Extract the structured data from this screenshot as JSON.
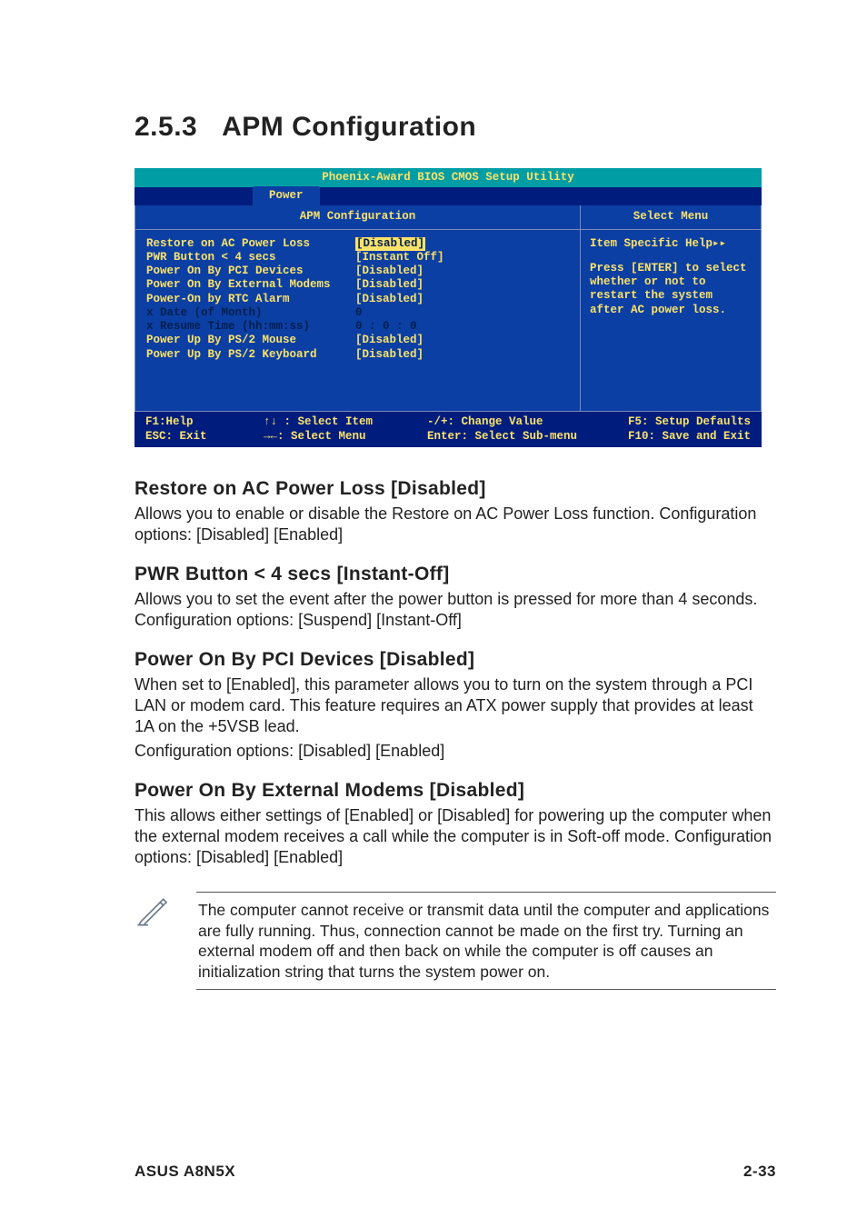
{
  "section": {
    "number": "2.5.3",
    "title": "APM Configuration"
  },
  "bios": {
    "title": "Phoenix-Award BIOS CMOS Setup Utility",
    "active_tab": "Power",
    "left_header": "APM Configuration",
    "right_header": "Select Menu",
    "rows": [
      {
        "label": "Restore on AC Power Loss",
        "value": "[Disabled]",
        "style": "highlight"
      },
      {
        "label": "PWR Button < 4 secs",
        "value": "[Instant Off]",
        "style": "normal"
      },
      {
        "label": "Power On By PCI Devices",
        "value": "[Disabled]",
        "style": "normal"
      },
      {
        "label": "Power On By External Modems",
        "value": "[Disabled]",
        "style": "normal"
      },
      {
        "label": "Power-On by RTC Alarm",
        "value": "[Disabled]",
        "style": "normal"
      },
      {
        "label": "x Date (of Month)",
        "value": "  0",
        "style": "dim"
      },
      {
        "label": "x Resume Time (hh:mm:ss)",
        "value": "0 : 0 : 0",
        "style": "dim"
      },
      {
        "label": "Power Up By PS/2 Mouse",
        "value": "[Disabled]",
        "style": "normal"
      },
      {
        "label": "Power Up By PS/2 Keyboard",
        "value": "[Disabled]",
        "style": "normal"
      }
    ],
    "help_title": "Item Specific Help",
    "help_body": "Press [ENTER] to select whether or not to restart the system after AC power loss.",
    "legend": {
      "f1": "F1:Help",
      "esc": "ESC: Exit",
      "updown": "↑↓ : Select Item",
      "leftright": "→←: Select Menu",
      "changeval": "-/+: Change Value",
      "submenu": "Enter: Select Sub-menu",
      "f5": "F5: Setup Defaults",
      "f10": "F10: Save and Exit"
    }
  },
  "items": {
    "restore": {
      "heading": "Restore on AC Power Loss [Disabled]",
      "p1": "Allows you to enable or disable the Restore on AC Power Loss function. Configuration options: [Disabled] [Enabled]"
    },
    "pwrbtn": {
      "heading": "PWR Button < 4 secs [Instant-Off]",
      "p1": "Allows you to set the event after the power button is pressed for more than 4 seconds. Configuration options: [Suspend] [Instant-Off]"
    },
    "pci": {
      "heading": "Power On By PCI Devices [Disabled]",
      "p1": "When set to [Enabled], this parameter allows you to turn on the system through a PCI LAN or modem card. This feature requires an ATX power supply that provides at least 1A on the +5VSB lead.",
      "p2": "Configuration options: [Disabled] [Enabled]"
    },
    "modem": {
      "heading": "Power On By External Modems [Disabled]",
      "p1": "This allows either settings of [Enabled] or [Disabled] for powering up the computer when the external modem receives a call while the computer is in Soft-off mode. Configuration options: [Disabled] [Enabled]"
    }
  },
  "note": "The computer cannot receive or transmit data until the computer and applications are fully running. Thus, connection cannot be made on the first try. Turning an external modem off and then back on while the computer is off causes an initialization string that turns the system power on.",
  "footer": {
    "left": "ASUS A8N5X",
    "right": "2-33"
  }
}
